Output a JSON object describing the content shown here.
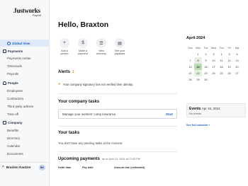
{
  "app": {
    "brand": "Justworks",
    "sub": "Payroll"
  },
  "sidebar": {
    "items": [
      {
        "label": "Global View",
        "type": "active"
      },
      {
        "label": "Payments",
        "type": "section"
      },
      {
        "label": "Payments center",
        "type": "sub"
      },
      {
        "label": "Timecards",
        "type": "sub"
      },
      {
        "label": "Payrolls",
        "type": "sub"
      },
      {
        "label": "People",
        "type": "section"
      },
      {
        "label": "Employees",
        "type": "sub"
      },
      {
        "label": "Contractors",
        "type": "sub"
      },
      {
        "label": "Third party admins",
        "type": "sub"
      },
      {
        "label": "Time off",
        "type": "sub"
      },
      {
        "label": "Company",
        "type": "section"
      },
      {
        "label": "Benefits",
        "type": "sub"
      },
      {
        "label": "Directory",
        "type": "sub"
      },
      {
        "label": "Calendar",
        "type": "sub"
      },
      {
        "label": "Documents",
        "type": "sub"
      }
    ],
    "user": {
      "name": "Braxton Kautzer",
      "initials": "BK"
    }
  },
  "main": {
    "greeting": "Hello, Braxton",
    "actions": [
      {
        "label": "Add a\nperson",
        "icon": "add-person-icon",
        "glyph": "+"
      },
      {
        "label": "Make a\npayment",
        "icon": "payment-icon",
        "glyph": "$"
      },
      {
        "label": "View\ndirectory",
        "icon": "directory-icon",
        "glyph": "☰"
      },
      {
        "label": "See your\npaystubs",
        "icon": "paystub-icon",
        "glyph": "▤"
      }
    ],
    "alerts": {
      "title": "Alerts",
      "count": "1",
      "text": "Your company signatory has not verified their identity."
    },
    "company_tasks": {
      "title": "Your company tasks",
      "task": "Manage your workers' comp insurance",
      "action": "Start"
    },
    "your_tasks": {
      "title": "Your tasks",
      "empty": "You don't have any pending tasks at the moment."
    },
    "payments": {
      "title": "Upcoming payments",
      "as_of": "as of April 15, 2024 at 12:00 PM",
      "headers": [
        "Debit date",
        "Pay date",
        "Amount due (estimated)"
      ]
    }
  },
  "calendar": {
    "title": "April 2024",
    "weekdays": [
      "Sun",
      "Mon",
      "Tue",
      "Wed",
      "Thu",
      "Fri",
      "Sat"
    ],
    "days": [
      "",
      "1",
      "2",
      "3",
      "4",
      "5",
      "6",
      "7",
      "8",
      "9",
      "10",
      "11",
      "12",
      "13",
      "14",
      "15",
      "16",
      "17",
      "18",
      "19",
      "20",
      "21",
      "22",
      "23",
      "24",
      "25",
      "26",
      "27",
      "28",
      "29",
      "30",
      "",
      "",
      "",
      ""
    ],
    "today": "15",
    "event_days": [
      "8",
      "15",
      "22"
    ],
    "events_title": "Events",
    "events_date": "Apr 15, 2024",
    "events_empty": "No events",
    "see_full": "See full calendar »"
  }
}
